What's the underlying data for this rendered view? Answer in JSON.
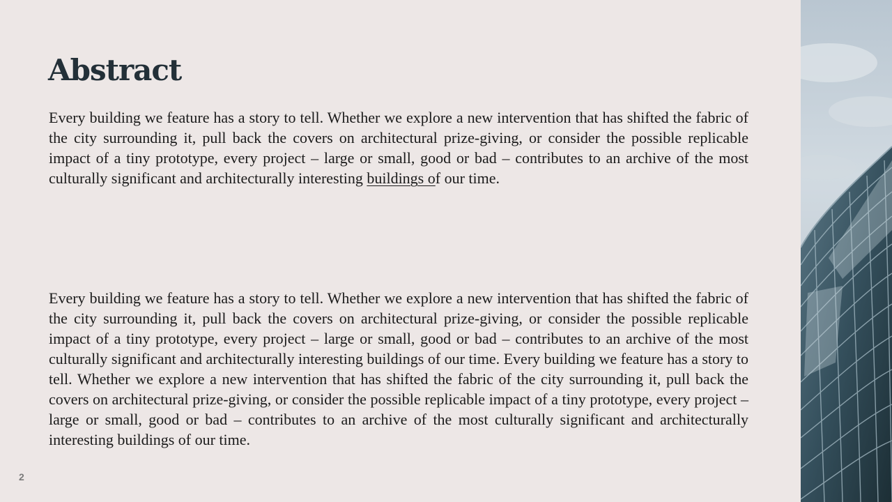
{
  "slide": {
    "title": "Abstract",
    "paragraph_1_main": "Every building we feature has a story to tell. Whether we explore a new intervention that has shifted the fabric of the city surrounding it, pull back the covers on architectural prize-giving, or consider the possible replicable impact of a tiny prototype, every project – large or small, good or bad – contributes to an archive of the most culturally significant and architecturally interesting ",
    "paragraph_1_link": "buildings o",
    "paragraph_1_end": "f our time.",
    "paragraph_2": "Every building we feature has a story to tell. Whether we explore a new intervention that has shifted the fabric of the city surrounding it, pull back the covers on architectural prize-giving, or consider the possible replicable impact of a tiny prototype, every project – large or small, good or bad – contributes to an archive of the most culturally significant and architecturally interesting buildings of our time. Every building we feature has a story to tell. Whether we explore a new intervention that has shifted the fabric of the city surrounding it, pull back the covers on architectural prize-giving, or consider the possible replicable impact of a tiny prototype, every project – large or small, good or bad – contributes to an archive of the most culturally significant and architecturally interesting buildings of our time.",
    "page_number": "2"
  },
  "photo": {
    "subject": "glass-office-building-photo",
    "sky_color": "#c6d1da",
    "glass_color": "#3f5966"
  }
}
